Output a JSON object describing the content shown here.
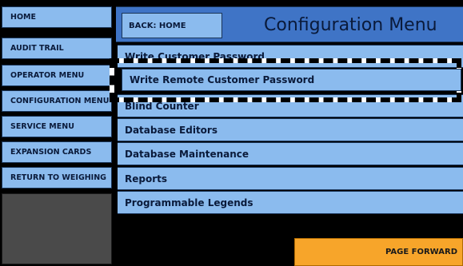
{
  "nav": {
    "items": [
      {
        "label": "HOME"
      },
      {
        "label": "AUDIT TRAIL"
      },
      {
        "label": "OPERATOR MENU"
      },
      {
        "label": "CONFIGURATION MENU"
      },
      {
        "label": "SERVICE MENU"
      },
      {
        "label": "EXPANSION CARDS"
      },
      {
        "label": "RETURN TO WEIGHING"
      }
    ]
  },
  "header": {
    "back_label": "BACK: HOME",
    "title": "Configuration Menu"
  },
  "menu": {
    "items": [
      {
        "label": "Write Customer Password"
      },
      {
        "label": "Write Remote Customer Password"
      },
      {
        "label": "Blind Counter"
      },
      {
        "label": "Database Editors"
      },
      {
        "label": "Database Maintenance"
      },
      {
        "label": "Reports"
      },
      {
        "label": "Programmable Legends"
      }
    ],
    "selected_index": 1
  },
  "footer": {
    "page_forward_label": "PAGE FORWARD"
  },
  "colors": {
    "button_light_blue": "#8bbbee",
    "header_blue": "#3f74c6",
    "page_forward_orange": "#f7a52a",
    "background": "#000000"
  }
}
